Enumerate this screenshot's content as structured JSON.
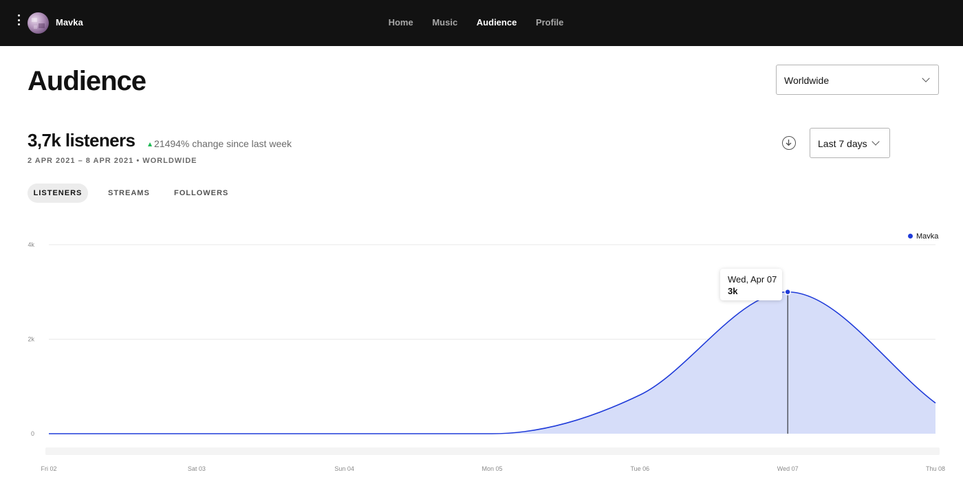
{
  "header": {
    "artist_name": "Mavka",
    "nav": [
      "Home",
      "Music",
      "Audience",
      "Profile"
    ],
    "active_nav": "Audience"
  },
  "page": {
    "title": "Audience",
    "region_select": "Worldwide",
    "range_select": "Last 7 days"
  },
  "summary": {
    "listeners": "3,7k listeners",
    "change": "21494% change since last week",
    "date_range": "2 APR 2021 – 8 APR 2021 • WORLDWIDE"
  },
  "tabs": [
    "LISTENERS",
    "STREAMS",
    "FOLLOWERS"
  ],
  "active_tab": "LISTENERS",
  "colors": {
    "line": "#1f3bd9",
    "fill": "#d6ddf9",
    "up_arrow": "#1db954"
  },
  "tooltip": {
    "date": "Wed, Apr 07",
    "value": "3k"
  },
  "chart_data": {
    "type": "area",
    "series": [
      {
        "name": "Mavka",
        "values": [
          0,
          0,
          0,
          0,
          820,
          3000,
          650
        ]
      }
    ],
    "categories": [
      "Fri 02",
      "Sat 03",
      "Sun 04",
      "Mon 05",
      "Tue 06",
      "Wed 07",
      "Thu 08"
    ],
    "y_ticks": [
      "0",
      "2k",
      "4k"
    ],
    "ylim": [
      0,
      4000
    ],
    "grid": true,
    "legend": "top-right",
    "highlighted_index": 5
  }
}
